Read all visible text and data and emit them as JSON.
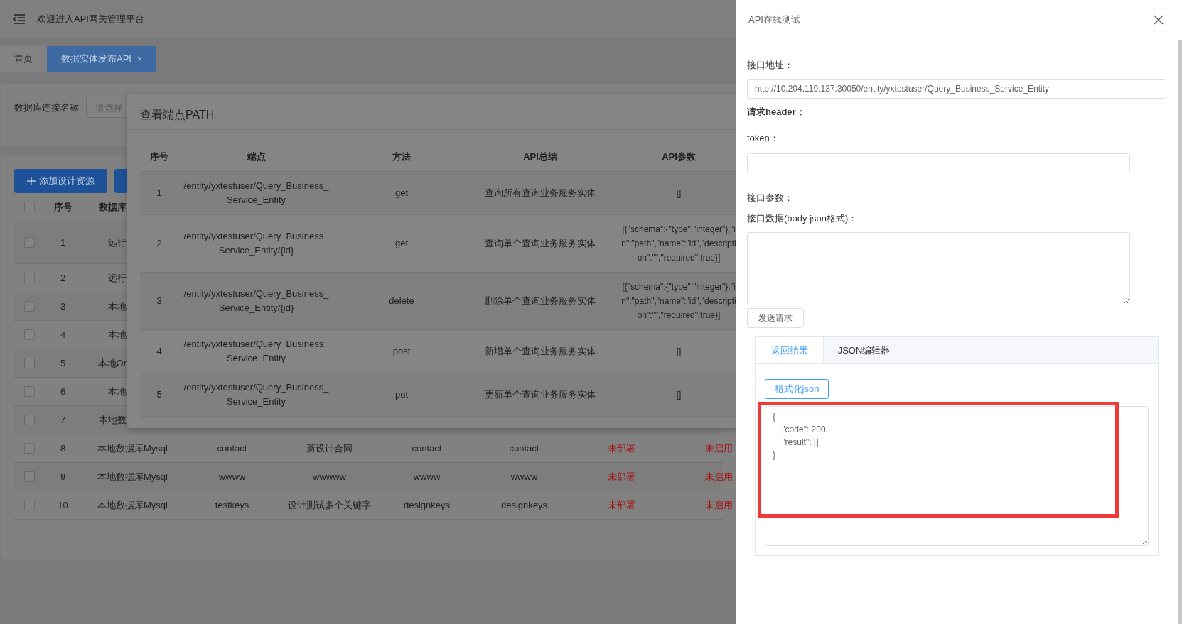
{
  "header": {
    "title": "欢迎进入API网关管理平台"
  },
  "tabs": [
    {
      "label": "首页",
      "selected": false
    },
    {
      "label": "数据实体发布API",
      "selected": true,
      "close": "×"
    }
  ],
  "filter": {
    "label": "数据库连接名称",
    "placeholder": "请选择"
  },
  "toolbar": {
    "add_button": "添加设计资源"
  },
  "table": {
    "header_checked": false,
    "columns": [
      "序号",
      "数据库"
    ],
    "rows": [
      {
        "checked": false,
        "cells": [
          "1",
          "远行"
        ]
      },
      {
        "checked": false,
        "cells": [
          "2",
          "远行"
        ]
      },
      {
        "checked": false,
        "cells": [
          "3",
          "本地"
        ]
      },
      {
        "checked": false,
        "cells": [
          "4",
          "本地"
        ]
      },
      {
        "checked": false,
        "cells": [
          "5",
          "本地Or"
        ]
      },
      {
        "checked": false,
        "cells": [
          "6",
          "本地"
        ]
      },
      {
        "checked": false,
        "cells": [
          "7",
          "本地数"
        ]
      },
      {
        "checked": false,
        "cells": [
          "8",
          "本地数据库Mysql",
          "contact",
          "新设计合同",
          "contact",
          "contact"
        ],
        "status": [
          "未部署",
          "未启用"
        ]
      },
      {
        "checked": false,
        "cells": [
          "9",
          "本地数据库Mysql",
          "wwww",
          "wwwww",
          "wwww",
          "wwww"
        ],
        "status": [
          "未部署",
          "未启用"
        ]
      },
      {
        "checked": false,
        "cells": [
          "10",
          "本地数据库Mysql",
          "testkeys",
          "设计测试多个关键字",
          "designkeys",
          "designkeys"
        ],
        "status": [
          "未部署",
          "未启用"
        ]
      }
    ]
  },
  "dialog": {
    "title": "查看端点PATH",
    "columns": [
      "序号",
      "端点",
      "方法",
      "API总结",
      "API参数"
    ],
    "rows": [
      {
        "no": "1",
        "endpoint": [
          "/entity/yxtestuser/Query_Business_",
          "Service_Entity"
        ],
        "method": "get",
        "summary": "查询所有查询业务服务实体",
        "params": [
          "[]"
        ]
      },
      {
        "no": "2",
        "endpoint": [
          "/entity/yxtestuser/Query_Business_",
          "Service_Entity/{id}"
        ],
        "method": "get",
        "summary": "查询单个查询业务服务实体",
        "params": [
          "[{\"schema\":{\"type\":\"integer\"},\"i",
          "n\":\"path\",\"name\":\"id\",\"descripti",
          "on\":\"\",\"required\":true}]"
        ]
      },
      {
        "no": "3",
        "endpoint": [
          "/entity/yxtestuser/Query_Business_",
          "Service_Entity/{id}"
        ],
        "method": "delete",
        "summary": "删除单个查询业务服务实体",
        "params": [
          "[{\"schema\":{\"type\":\"integer\"},\"i",
          "n\":\"path\",\"name\":\"id\",\"descripti",
          "on\":\"\",\"required\":true}]"
        ]
      },
      {
        "no": "4",
        "endpoint": [
          "/entity/yxtestuser/Query_Business_",
          "Service_Entity"
        ],
        "method": "post",
        "summary": "新增单个查询业务服务实体",
        "params": [
          "[]"
        ]
      },
      {
        "no": "5",
        "endpoint": [
          "/entity/yxtestuser/Query_Business_",
          "Service_Entity"
        ],
        "method": "put",
        "summary": "更新单个查询业务服务实体",
        "params": [
          "[]"
        ]
      }
    ]
  },
  "drawer": {
    "title": "API在线测试",
    "url_label": "接口地址：",
    "url": "http://10.204.119.137:30050/entity/yxtestuser/Query_Business_Service_Entity",
    "header_label": "请求header：",
    "token_label": "token：",
    "params_label": "接口参数：",
    "body_label": "接口数据(body json格式)：",
    "send_button": "发送请求",
    "result_tabs": [
      {
        "label": "返回结果",
        "selected": true
      },
      {
        "label": "JSON编辑器",
        "selected": false
      }
    ],
    "format_button": "格式化json",
    "result": "{\n    \"code\": 200,\n    \"result\": []\n}"
  }
}
